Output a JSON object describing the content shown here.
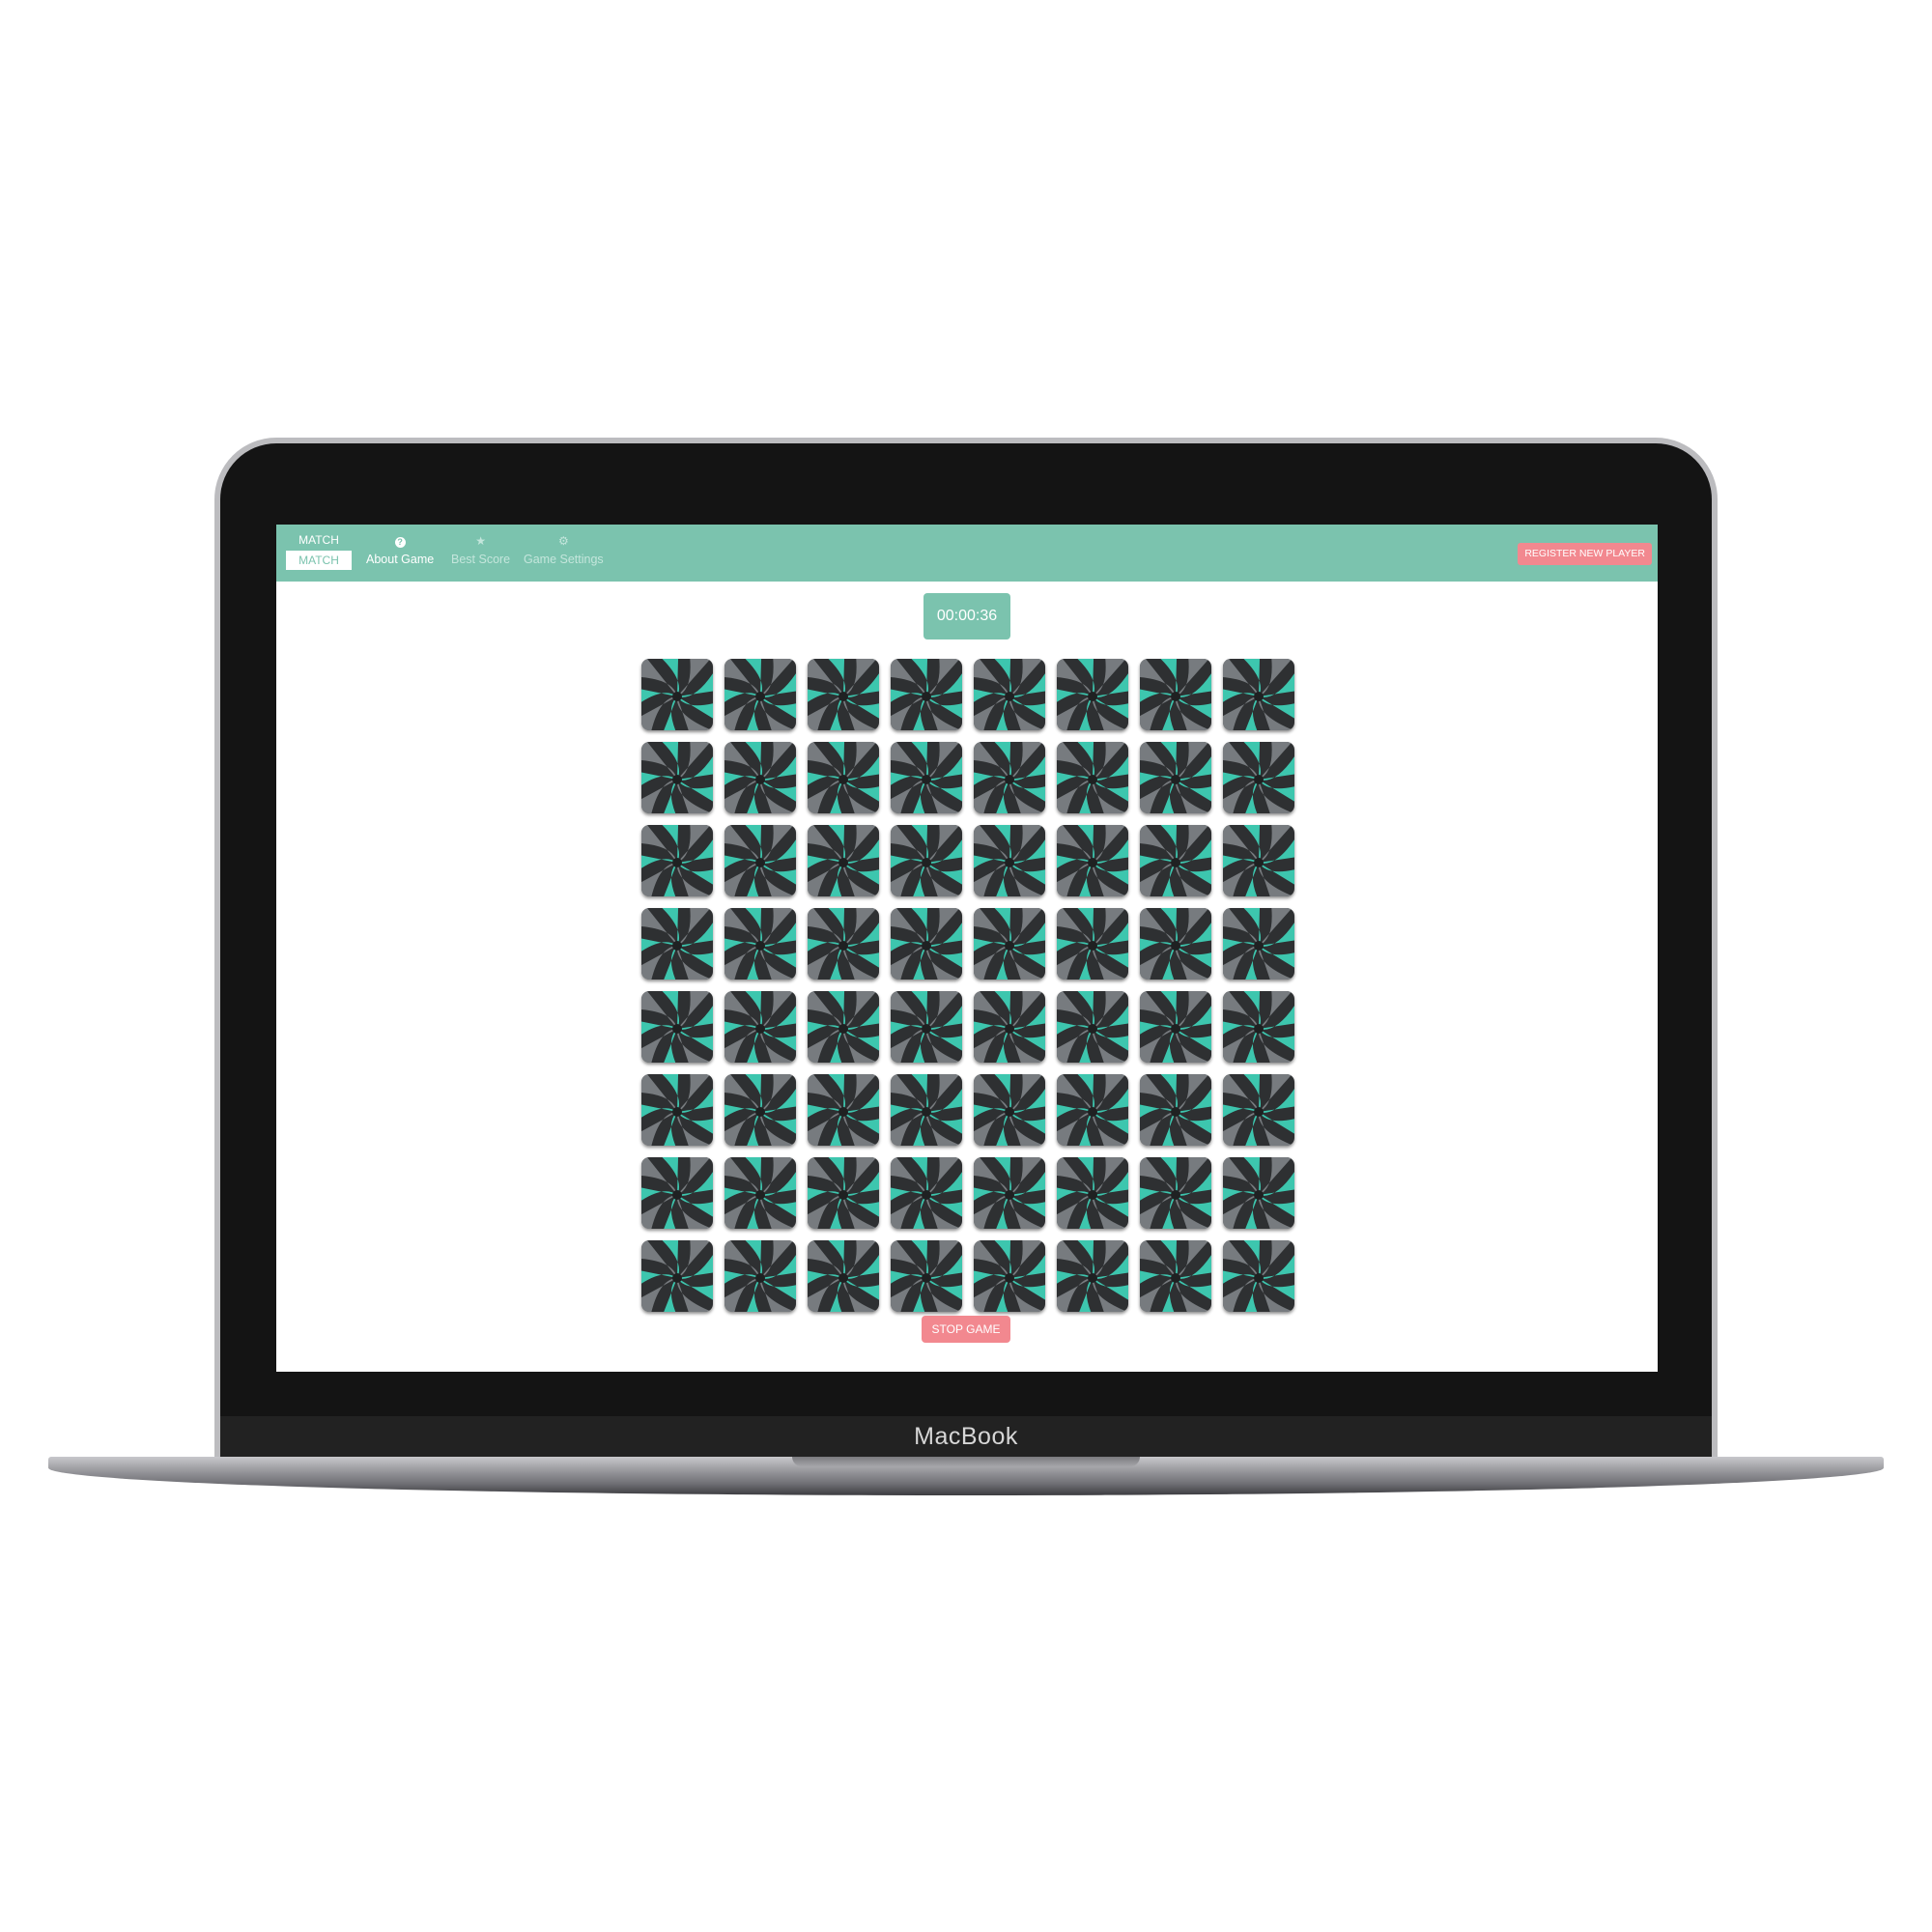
{
  "device": {
    "brand_label": "MacBook"
  },
  "navbar": {
    "logo_top": "MATCH",
    "logo_bottom": "MATCH",
    "items": [
      {
        "label": "About Game",
        "icon": "question-circle-icon",
        "active": true
      },
      {
        "label": "Best Score",
        "icon": "star-icon",
        "active": false
      },
      {
        "label": "Game Settings",
        "icon": "gear-icon",
        "active": false
      }
    ],
    "register_label": "REGISTER NEW PLAYER"
  },
  "game": {
    "timer": "00:00:36",
    "rows": 8,
    "cols": 8,
    "card_back": "abstract-swirl-card-back",
    "stop_label": "STOP GAME"
  },
  "colors": {
    "accent": "#7bc3ae",
    "button_pink": "#f2888f",
    "card_teal": "#3ecfb5",
    "card_dark": "#2e3032"
  }
}
